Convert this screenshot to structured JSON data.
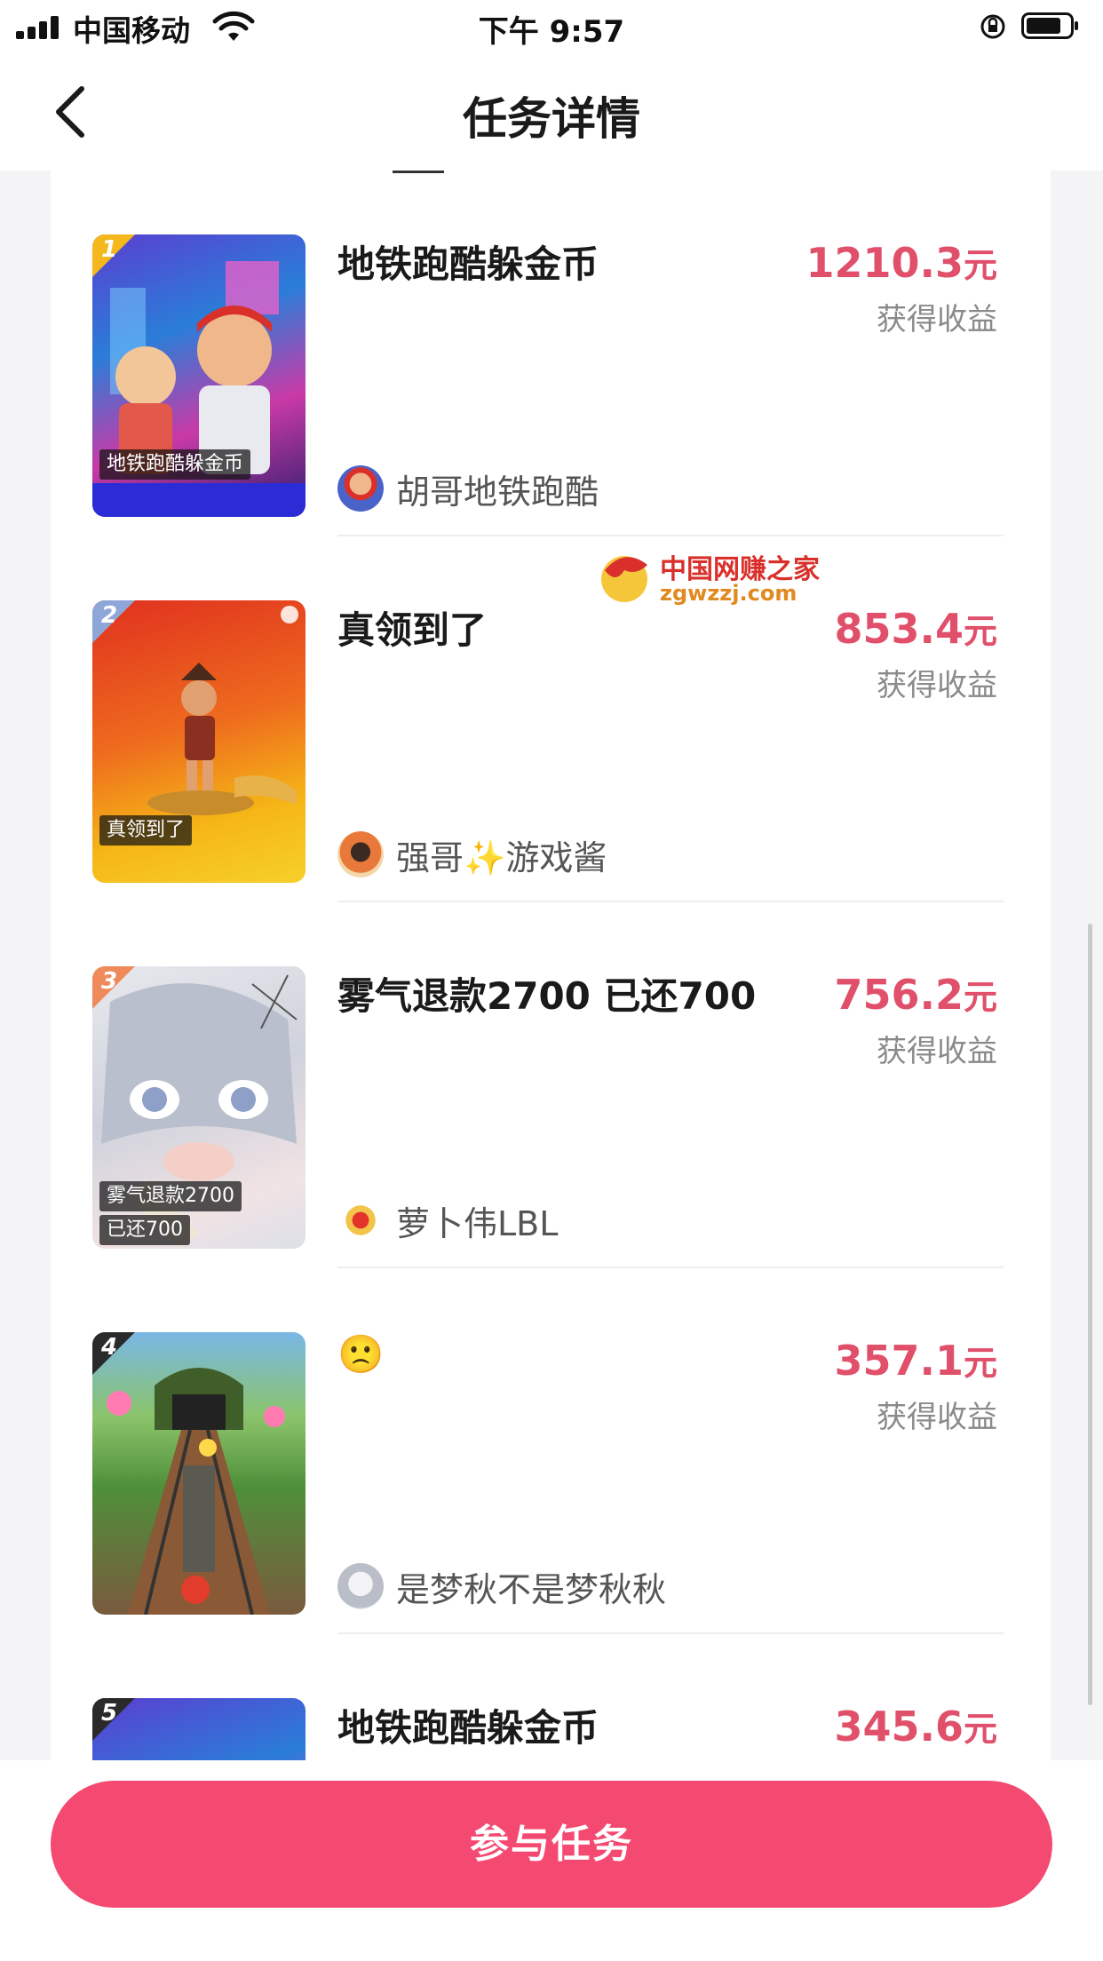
{
  "status_bar": {
    "carrier": "中国移动",
    "time": "下午 9:57"
  },
  "nav": {
    "title": "任务详情"
  },
  "watermark": {
    "text": "中国网赚之家",
    "url": "zgwzzj.com"
  },
  "colors": {
    "accent": "#f44a72",
    "amount": "#e0506b"
  },
  "earn_label": "获得收益",
  "unit": "元",
  "tasks": [
    {
      "rank": "1",
      "title": "地铁跑酷躲金币",
      "amount": "1210.3",
      "thumb_caption": [
        "地铁跑酷躲金币"
      ],
      "author": "胡哥地铁跑酷"
    },
    {
      "rank": "2",
      "title": "真领到了",
      "amount": "853.4",
      "thumb_caption": [
        "真领到了"
      ],
      "author": "强哥✨游戏酱"
    },
    {
      "rank": "3",
      "title": "雾气退款2700 已还700",
      "amount": "756.2",
      "thumb_caption": [
        "雾气退款2700",
        "已还700"
      ],
      "author": "萝卜伟LBL"
    },
    {
      "rank": "4",
      "title": "🙁",
      "amount": "357.1",
      "thumb_caption": [],
      "author": "是梦秋不是梦秋秋"
    },
    {
      "rank": "5",
      "title": "地铁跑酷躲金币",
      "amount": "345.6",
      "thumb_caption": [],
      "author": ""
    }
  ],
  "action": {
    "join_label": "参与任务"
  }
}
